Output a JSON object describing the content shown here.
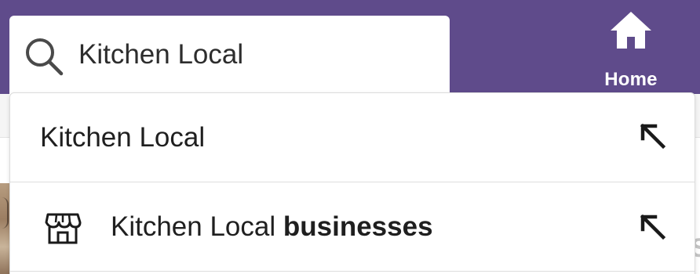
{
  "header": {
    "background_color": "#5f4b8b",
    "home": {
      "label": "Home",
      "icon": "home-icon"
    }
  },
  "search": {
    "value": "Kitchen Local",
    "icon": "search-icon"
  },
  "suggestions": [
    {
      "text": "Kitchen Local",
      "bold": "",
      "icon": "",
      "action_icon": "fill-query-arrow-icon"
    },
    {
      "text": "Kitchen Local ",
      "bold": "businesses",
      "icon": "storefront-icon",
      "action_icon": "fill-query-arrow-icon"
    }
  ]
}
